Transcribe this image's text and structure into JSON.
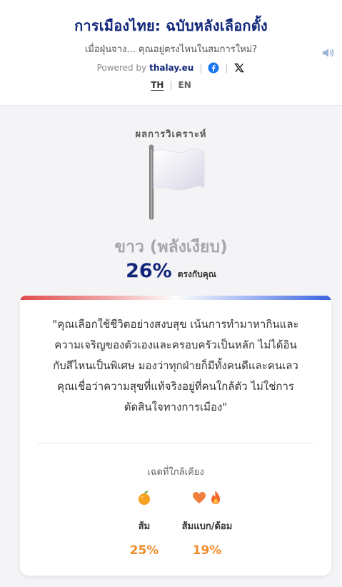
{
  "header": {
    "title": "การเมืองไทย: ฉบับหลังเลือกตั้ง",
    "subtitle": "เมื่อฝุ่นจาง... คุณอยู่ตรงไหนในสมการใหม่?",
    "powered_by": "Powered by",
    "brand": "thalay.eu",
    "sound_icon": "speaker-icon",
    "facebook_icon": "facebook-icon",
    "x_icon": "x-icon"
  },
  "languages": {
    "th": "TH",
    "en": "EN",
    "active": "TH"
  },
  "result": {
    "label": "ผลการวิเคราะห์",
    "flag_icon": "white-flag-icon",
    "name": "ขาว (พลังเงียบ)",
    "match_percent": "26%",
    "match_text": "ตรงกับคุณ"
  },
  "card": {
    "quote_lines": [
      "\"คุณเลือกใช้ชีวิตอย่างสงบสุข เน้นการทำมาหากินและ",
      "ความเจริญของตัวเองและครอบครัวเป็นหลัก ไม่ได้อิน",
      "กับสีไหนเป็นพิเศษ มองว่าทุกฝ่ายก็มีทั้งคนดีและคนเลว",
      "คุณเชื่อว่าความสุขที่แท้จริงอยู่ที่คนใกล้ตัว ไม่ใช่การ",
      "ตัดสินใจทางการเมือง\""
    ],
    "nearby_label": "เฉดที่ใกล้เคียง",
    "nearby": [
      {
        "name": "ส้ม",
        "percent": "25%",
        "icons": [
          "orange-icon"
        ]
      },
      {
        "name": "ส้มแบก/ด้อม",
        "percent": "19%",
        "icons": [
          "orange-heart-icon",
          "fire-icon"
        ]
      }
    ]
  },
  "colors": {
    "title": "#12277a",
    "result_name": "#a7a7ab",
    "percent_accent": "#f28c2a",
    "gradient_left": "#e04c4c",
    "gradient_right": "#3a64e0"
  }
}
